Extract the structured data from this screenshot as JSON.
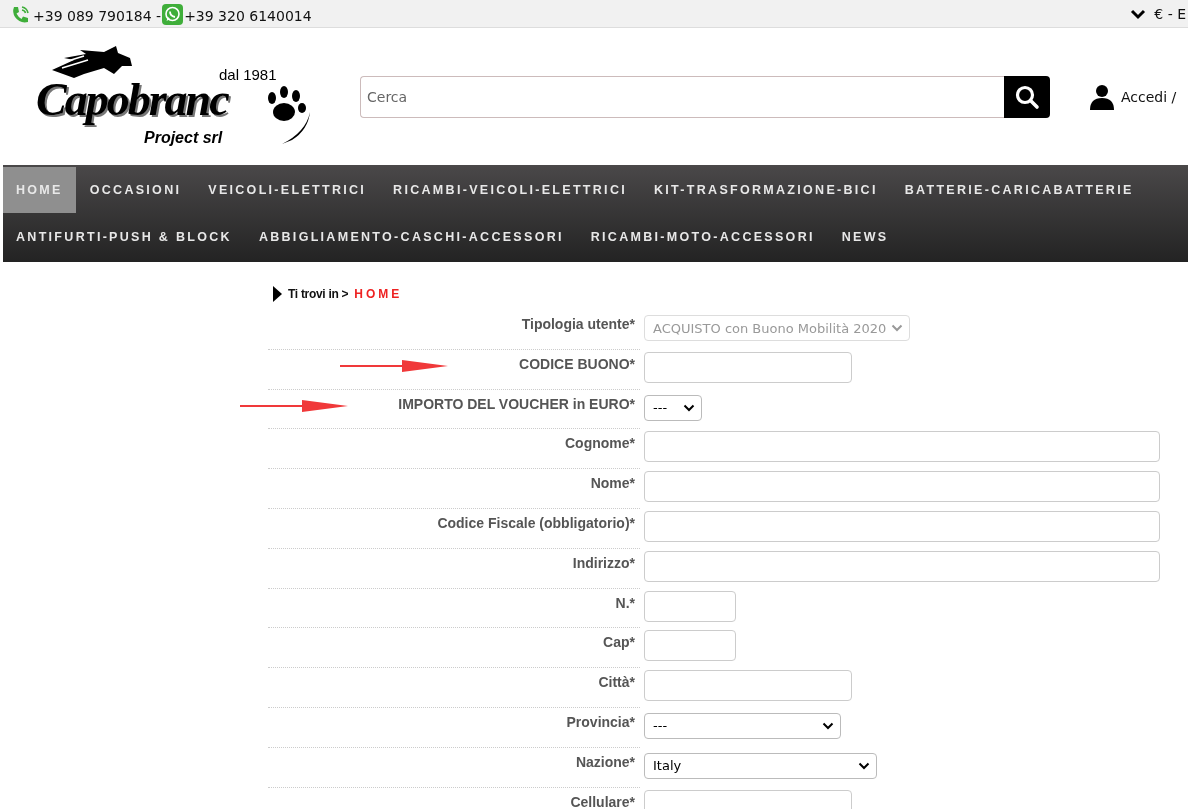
{
  "top_bar": {
    "phone": "+39 089 790184 - ",
    "whatsapp": "+39 320 6140014",
    "currency": "€ - E"
  },
  "header": {
    "logo": {
      "since": "dal 1981",
      "name": "Capobranc",
      "company": "Project srl"
    },
    "search": {
      "placeholder": "Cerca"
    },
    "account": "Accedi /"
  },
  "nav": {
    "items": [
      {
        "label": "HOME",
        "selected": true
      },
      {
        "label": "OCCASIONI",
        "selected": false
      },
      {
        "label": "VEICOLI-ELETTRICI",
        "selected": false
      },
      {
        "label": "RICAMBI-VEICOLI-ELETTRICI",
        "selected": false
      },
      {
        "label": "KIT-TRASFORMAZIONE-BICI",
        "selected": false
      },
      {
        "label": "BATTERIE-CARICABATTERIE",
        "selected": false
      },
      {
        "label": "ANTIFURTI-PUSH & BLOCK",
        "selected": false
      },
      {
        "label": "ABBIGLIAMENTO-CASCHI-ACCESSORI",
        "selected": false
      },
      {
        "label": "RICAMBI-MOTO-ACCESSORI",
        "selected": false
      },
      {
        "label": "NEWS",
        "selected": false
      }
    ]
  },
  "breadcrumb": {
    "prefix": "Ti trovi in >",
    "current": "HOME"
  },
  "form": {
    "rows": [
      {
        "label": "Tipologia utente*",
        "kind": "select",
        "value": "ACQUISTO con Buono Mobilità 2020",
        "disabled": true,
        "marked": false
      },
      {
        "label": "CODICE BUONO*",
        "kind": "text",
        "marked": true
      },
      {
        "label": "IMPORTO DEL VOUCHER in EURO*",
        "kind": "select",
        "value": "---",
        "disabled": false,
        "marked": true
      },
      {
        "label": "Cognome*",
        "kind": "text",
        "marked": false
      },
      {
        "label": "Nome*",
        "kind": "text",
        "marked": false
      },
      {
        "label": "Codice Fiscale (obbligatorio)*",
        "kind": "text",
        "marked": false
      },
      {
        "label": "Indirizzo*",
        "kind": "text",
        "marked": false
      },
      {
        "label": "N.*",
        "kind": "text",
        "marked": false
      },
      {
        "label": "Cap*",
        "kind": "text",
        "marked": false
      },
      {
        "label": "Città*",
        "kind": "text",
        "marked": false
      },
      {
        "label": "Provincia*",
        "kind": "select",
        "value": "---",
        "disabled": false,
        "marked": false
      },
      {
        "label": "Nazione*",
        "kind": "select",
        "value": "Italy",
        "disabled": false,
        "marked": false
      },
      {
        "label": "Cellulare*",
        "kind": "text",
        "marked": false
      }
    ]
  }
}
